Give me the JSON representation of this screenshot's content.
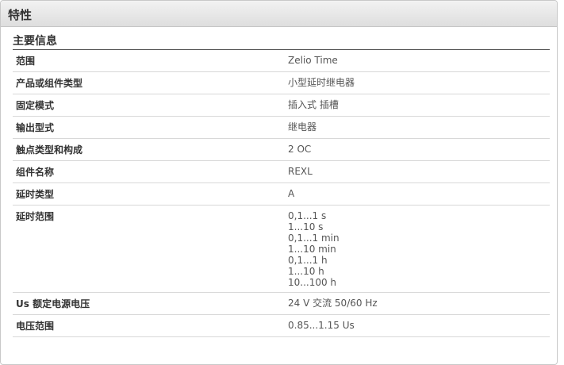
{
  "header": {
    "title": "特性"
  },
  "section": {
    "title": "主要信息"
  },
  "rows": [
    {
      "label": "范围",
      "values": [
        "Zelio Time"
      ]
    },
    {
      "label": "产品或组件类型",
      "values": [
        "小型延时继电器"
      ]
    },
    {
      "label": "固定模式",
      "values": [
        "插入式 插槽"
      ]
    },
    {
      "label": "输出型式",
      "values": [
        "继电器"
      ]
    },
    {
      "label": "触点类型和构成",
      "values": [
        "2 OC"
      ]
    },
    {
      "label": "组件名称",
      "values": [
        "REXL"
      ]
    },
    {
      "label": "延时类型",
      "values": [
        "A"
      ]
    },
    {
      "label": "延时范围",
      "values": [
        "0,1...1 s",
        "1...10 s",
        "0,1...1 min",
        "1...10 min",
        "0,1...1 h",
        "1...10 h",
        "10...100 h"
      ]
    },
    {
      "label": "Us 额定电源电压",
      "values": [
        "24 V 交流 50/60 Hz"
      ]
    },
    {
      "label": "电压范围",
      "values": [
        "0.85...1.15 Us"
      ]
    }
  ]
}
